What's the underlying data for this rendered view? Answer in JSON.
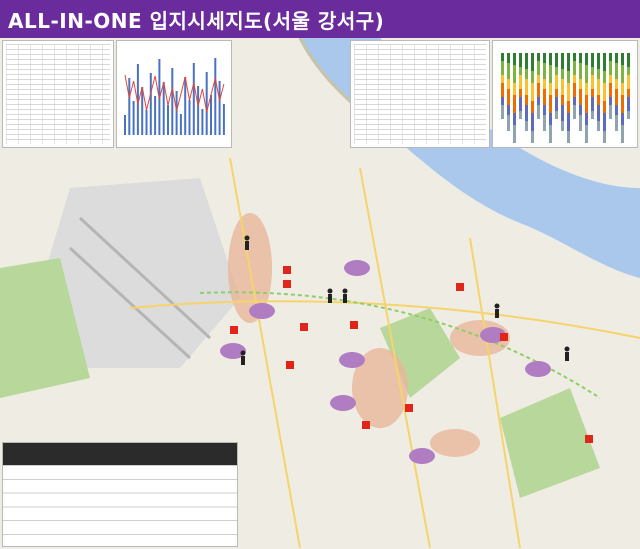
{
  "banner": {
    "title": "ALL-IN-ONE 입지시세지도(서울 강서구)"
  },
  "colors": {
    "banner": "#6a2c9c",
    "river": "#a9c8ec",
    "park": "#b8d79a",
    "dense_area": "#e9b79a",
    "marker_red": "#e0261b",
    "marker_purple": "#b07cc2"
  },
  "icons": [
    "pedestrian-icon",
    "location-pin-icon",
    "price-label-icon",
    "school-zone-icon"
  ]
}
